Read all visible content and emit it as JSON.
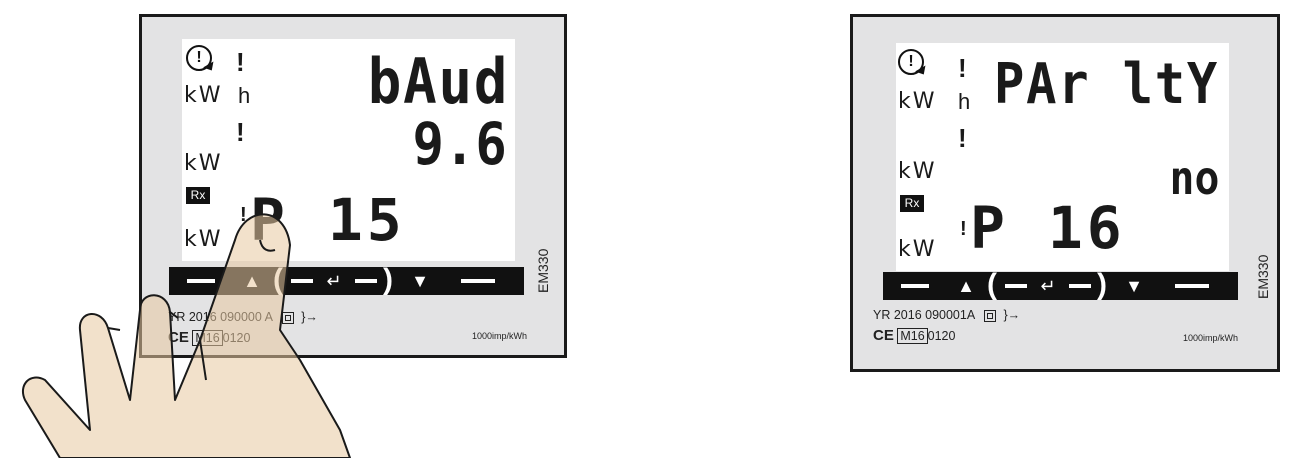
{
  "meters": [
    {
      "id": "left",
      "symbols": {
        "kw": "kW",
        "h": "h",
        "excl": "!",
        "rx": "Rx",
        "cycle": "!"
      },
      "display": {
        "top": "bAud",
        "middle": "9.6",
        "page_prefix": "!",
        "page": "P 15"
      },
      "buttons": [
        "▲",
        "↵",
        "▼"
      ],
      "model": "EM330",
      "serial": "YR 2016 090000 A",
      "cert": "0120",
      "cert_box": "M16",
      "ce": "CE",
      "impulse": "1000imp/kWh"
    },
    {
      "id": "right",
      "symbols": {
        "kw": "kW",
        "h": "h",
        "excl": "!",
        "rx": "Rx",
        "cycle": "!"
      },
      "display": {
        "top": "PAr ltY",
        "middle": "no",
        "page_prefix": "!",
        "page": "P 16"
      },
      "buttons": [
        "▲",
        "↵",
        "▼"
      ],
      "model": "EM330",
      "serial": "YR 2016 090001A",
      "cert": "0120",
      "cert_box": "M16",
      "ce": "CE",
      "impulse": "1000imp/kWh"
    }
  ],
  "colors": {
    "panel": "#e3e3e4",
    "lcd": "#ffffff",
    "segment": "#1a1a1a",
    "hand_fill": "#e8c9a0",
    "hand_stroke": "#1a1a1a"
  },
  "icons": [
    "cycle-warning-icon",
    "rx-indicator-icon",
    "up-arrow-icon",
    "enter-icon",
    "down-arrow-icon",
    "double-insulation-icon",
    "pulse-output-icon",
    "pointing-hand-icon"
  ]
}
